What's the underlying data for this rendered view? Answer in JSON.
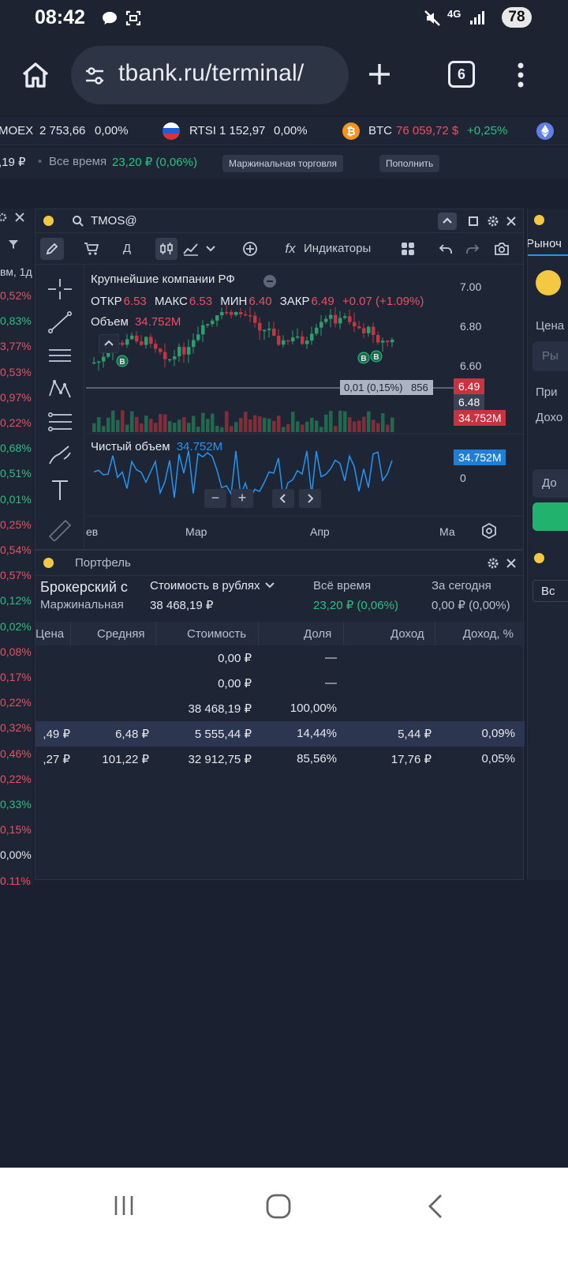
{
  "status_bar": {
    "time": "08:42",
    "network": "4G",
    "battery": "78"
  },
  "browser": {
    "url": "tbank.ru/terminal/",
    "tab_count": "6"
  },
  "ticker": [
    {
      "name": "MOEX",
      "value": "2 753,66",
      "change": "0,00%"
    },
    {
      "name": "RTSI",
      "value": "1 152,97",
      "change": "0,00%"
    },
    {
      "name": "BTC",
      "value": "76 059,72 $",
      "change": "+0,25%"
    }
  ],
  "account_bar": {
    "balance_fragment": ",19 ₽",
    "all_time_label": "Все время",
    "all_time_value": "23,20 ₽ (0,06%)",
    "margin_button": "Маржинальная торговля",
    "topup_button": "Пополнить"
  },
  "left_list": {
    "header_fragment": "вм, 1д",
    "changes": [
      {
        "text": "0,52%",
        "color": "red"
      },
      {
        "text": "0,83%",
        "color": "green"
      },
      {
        "text": "3,77%",
        "color": "red"
      },
      {
        "text": "0,53%",
        "color": "red"
      },
      {
        "text": "0,97%",
        "color": "red"
      },
      {
        "text": "0,22%",
        "color": "red"
      },
      {
        "text": "0,68%",
        "color": "green"
      },
      {
        "text": "0,51%",
        "color": "green"
      },
      {
        "text": "0,01%",
        "color": "green"
      },
      {
        "text": "0,25%",
        "color": "red"
      },
      {
        "text": "0,54%",
        "color": "red"
      },
      {
        "text": "0,57%",
        "color": "red"
      },
      {
        "text": "0,12%",
        "color": "green"
      },
      {
        "text": "0,02%",
        "color": "green"
      },
      {
        "text": "0,08%",
        "color": "red"
      },
      {
        "text": "0,17%",
        "color": "red"
      },
      {
        "text": "0,22%",
        "color": "red"
      },
      {
        "text": "0,32%",
        "color": "red"
      },
      {
        "text": "0,46%",
        "color": "red"
      },
      {
        "text": "0,22%",
        "color": "red"
      },
      {
        "text": "0,33%",
        "color": "green"
      },
      {
        "text": "0,15%",
        "color": "red"
      },
      {
        "text": "0,00%",
        "color": "white"
      },
      {
        "text": "0,11%",
        "color": "red"
      }
    ]
  },
  "chart_panel": {
    "ticker": "TMOS@",
    "interval": "Д",
    "indicators_label": "Индикаторы",
    "instrument_name": "Крупнейшие компании РФ",
    "ohlc": {
      "open_label": "ОТКР",
      "open": "6.53",
      "high_label": "МАКС",
      "high": "6.53",
      "low_label": "МИН",
      "low": "6.40",
      "close_label": "ЗАКР",
      "close": "6.49",
      "change": "+0.07 (+1.09%)"
    },
    "volume_label": "Объем",
    "volume_value": "34.752M",
    "net_volume_label": "Чистый объем",
    "net_volume_value": "34.752M",
    "price_ticks": [
      "7.00",
      "6.80",
      "6.60"
    ],
    "last_price": "6.49",
    "bid_price": "6.48",
    "volume_badge": "34.752M",
    "spread_label": "0,01 (0,15%)",
    "spread_qty": "856",
    "net_volume_badge": "34.752M",
    "net_zero": "0",
    "time_labels": [
      "ев",
      "Мар",
      "Апр",
      "Ма"
    ],
    "trade_marker": "B"
  },
  "right_panel": {
    "tab_fragment": "Рыноч",
    "price_fragment": "Цена",
    "market_fragment": "Ры",
    "at_fragment": "При",
    "income_fragment": "Дохо",
    "button_fragment": "До",
    "all_fragment": "Вс"
  },
  "portfolio": {
    "title": "Портфель",
    "account_name": "Брокерский с",
    "account_type": "Маржинальная",
    "cost_label": "Стоимость в рублях",
    "cost_value": "38 468,19 ₽",
    "all_time_label": "Всё время",
    "all_time_value": "23,20 ₽ (0,06%)",
    "today_label": "За сегодня",
    "today_value": "0,00 ₽ (0,00%)",
    "columns": [
      "Цена",
      "Средняя",
      "Стоимость",
      "Доля",
      "Доход",
      "Доход, %"
    ],
    "rows": [
      {
        "price": "",
        "avg": "",
        "value": "0,00 ₽",
        "share": "—",
        "income": "",
        "income_pct": ""
      },
      {
        "price": "",
        "avg": "",
        "value": "0,00 ₽",
        "share": "—",
        "income": "",
        "income_pct": ""
      },
      {
        "price": "",
        "avg": "",
        "value": "38 468,19 ₽",
        "share": "100,00%",
        "income": "",
        "income_pct": ""
      },
      {
        "price": ",49 ₽",
        "avg": "6,48 ₽",
        "value": "5 555,44 ₽",
        "share": "14,44%",
        "income": "5,44 ₽",
        "income_pct": "0,09%"
      },
      {
        "price": ",27 ₽",
        "avg": "101,22 ₽",
        "value": "32 912,75 ₽",
        "share": "85,56%",
        "income": "17,76 ₽",
        "income_pct": "0,05%"
      }
    ]
  },
  "colors": {
    "green": "#26c281",
    "red": "#f04e5e",
    "accent_blue": "#2196f3",
    "yellow_dot": "#f5c842"
  }
}
